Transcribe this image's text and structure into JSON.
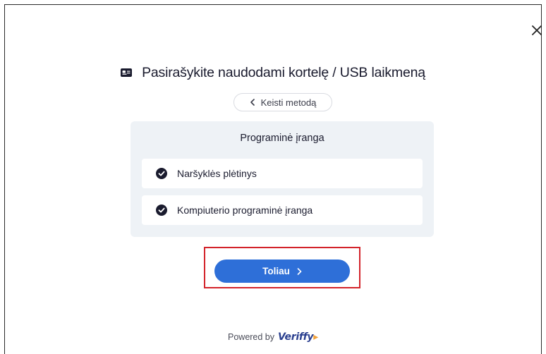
{
  "dialog": {
    "close_icon": "close-icon",
    "title": "Pasirašykite naudodami kortelę / USB laikmeną",
    "title_icon": "id-card-icon",
    "back_label": "Keisti metodą",
    "panel_title": "Programinė įranga",
    "options": [
      {
        "label": "Naršyklės plėtinys",
        "icon": "check-circle-icon",
        "checked": true
      },
      {
        "label": "Kompiuterio programinė įranga",
        "icon": "check-circle-icon",
        "checked": true
      }
    ],
    "next_label": "Toliau",
    "powered_by": "Powered by",
    "brand": "Veriffy",
    "colors": {
      "accent": "#2e6fd8",
      "highlight": "#d3232a",
      "panel_bg": "#eef2f6",
      "text": "#1a1b2e"
    }
  }
}
